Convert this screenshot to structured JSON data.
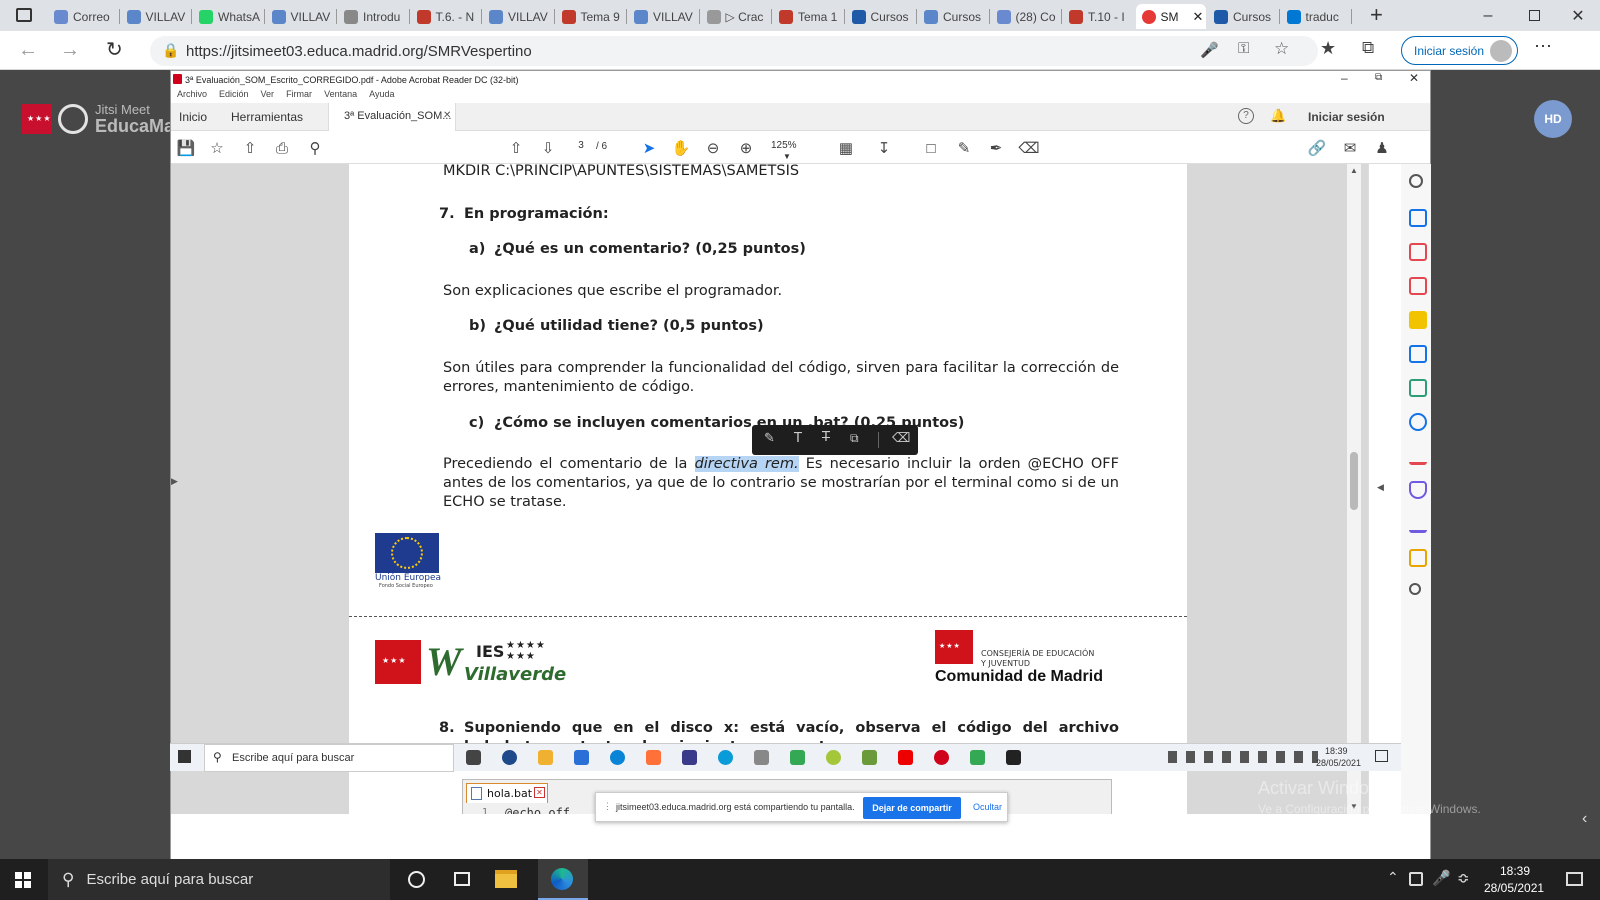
{
  "browser": {
    "tabs": [
      {
        "label": "Correo",
        "color": "#6a8ad0"
      },
      {
        "label": "VILLAV",
        "color": "#5b86c9"
      },
      {
        "label": "WhatsA",
        "color": "#25d366"
      },
      {
        "label": "VILLAV",
        "color": "#5b86c9"
      },
      {
        "label": "Introdu",
        "color": "#888888"
      },
      {
        "label": "T.6. - N",
        "color": "#c0392b"
      },
      {
        "label": "VILLAV",
        "color": "#5b86c9"
      },
      {
        "label": "Tema 9",
        "color": "#c0392b"
      },
      {
        "label": "VILLAV",
        "color": "#5b86c9"
      },
      {
        "label": "▷ Crac",
        "color": "#999999"
      },
      {
        "label": "Tema 1",
        "color": "#c0392b"
      },
      {
        "label": "Cursos",
        "color": "#1e5aa8"
      },
      {
        "label": "Cursos",
        "color": "#5b86c9"
      },
      {
        "label": "(28) Co",
        "color": "#6a8ad0"
      },
      {
        "label": "T.10 - I",
        "color": "#c0392b"
      },
      {
        "label": "SM",
        "color": "#e53935",
        "active": true
      },
      {
        "label": "Cursos",
        "color": "#1e5aa8"
      },
      {
        "label": "traduc",
        "color": "#0078d4"
      }
    ],
    "url": "https://jitsimeet03.educa.madrid.org/SMRVespertino",
    "signin_label": "Iniciar sesión"
  },
  "jitsi": {
    "brand_top": "Jitsi Meet",
    "brand_bottom": "EducaMadrid",
    "avatar_initials": "HD"
  },
  "acrobat": {
    "title": "3ª Evaluación_SOM_Escrito_CORREGIDO.pdf - Adobe Acrobat Reader DC (32-bit)",
    "menu": [
      "Archivo",
      "Edición",
      "Ver",
      "Firmar",
      "Ventana",
      "Ayuda"
    ],
    "tabs": {
      "home": "Inicio",
      "tools": "Herramientas",
      "doc": "3ª Evaluación_SOM..."
    },
    "signin": "Iniciar sesión",
    "page_current": "3",
    "page_total": "/ 6",
    "zoom": "125%"
  },
  "doc": {
    "line_top": "MKDIR C:\\PRINCIP\\APUNTES\\SISTEMAS\\SAMETSIS",
    "q7_num": "7.",
    "q7_title": "En programación:",
    "q7a_label": "a)",
    "q7a_text": "¿Qué es un comentario? (0,25 puntos)",
    "q7a_answer": "Son explicaciones que escribe el programador.",
    "q7b_label": "b)",
    "q7b_text": "¿Qué utilidad tiene? (0,5 puntos)",
    "q7b_answer": "Son útiles para comprender la funcionalidad del código, sirven para facilitar la corrección de errores, mantenimiento de código.",
    "q7c_label": "c)",
    "q7c_text": "¿Cómo se incluyen comentarios en un .bat? (0,25 puntos)",
    "q7c_answer_pre": "Precediendo el comentario de la ",
    "q7c_answer_hl": "directiva rem.",
    "q7c_answer_post": " Es necesario incluir la orden @ECHO OFF antes de los comentarios, ya que de lo contrario se mostrarían por el terminal como si de un ECHO se tratase.",
    "eu_label": "Unión Europea",
    "eu_sub": "Fondo Social Europeo",
    "ies_top": "IES",
    "ies_bottom": "Villaverde",
    "consejeria_1": "CONSEJERÍA DE EDUCACIÓN",
    "consejeria_2": "Y JUVENTUD",
    "cam": "Comunidad de Madrid",
    "q8_num": "8.",
    "q8_text": "Suponiendo que en el disco x: está vacío, observa el código del archivo hola.bat y contesta a las siguientes preguntas:",
    "code_tab": "hola.bat",
    "code_line_num": "1",
    "code_line": "@echo off"
  },
  "share_banner": {
    "text": "jitsimeet03.educa.madrid.org está compartiendo tu pantalla.",
    "stop": "Dejar de compartir",
    "hide": "Ocultar"
  },
  "inner_taskbar": {
    "search": "Escribe aquí para buscar",
    "time": "18:39",
    "date": "28/05/2021"
  },
  "watermark": {
    "line1": "Activar Windows",
    "line2": "Ve a Configuración para activar Windows."
  },
  "taskbar": {
    "search": "Escribe aquí para buscar",
    "time": "18:39",
    "date": "28/05/2021"
  }
}
